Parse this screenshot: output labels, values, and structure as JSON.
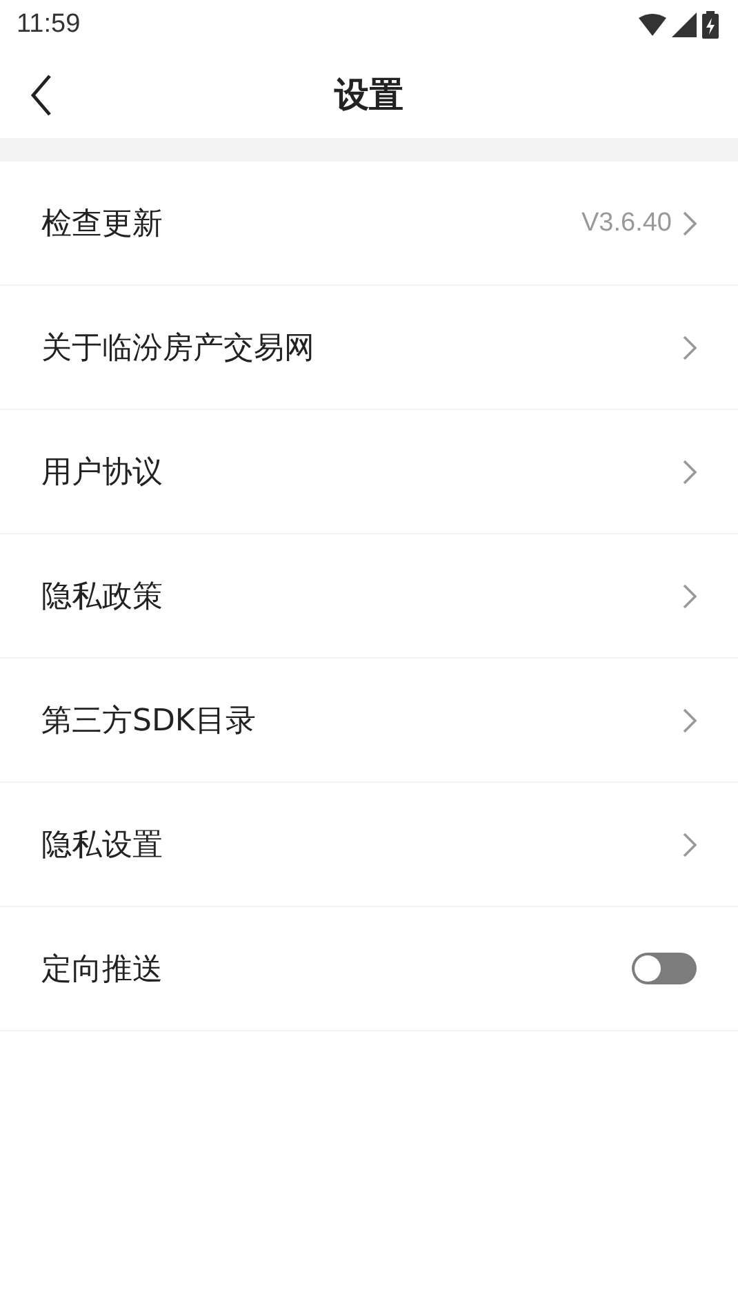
{
  "status_bar": {
    "time": "11:59"
  },
  "header": {
    "title": "设置"
  },
  "rows": [
    {
      "kind": "link",
      "label": "检查更新",
      "value": "V3.6.40"
    },
    {
      "kind": "link",
      "label": "关于临汾房产交易网"
    },
    {
      "kind": "link",
      "label": "用户协议"
    },
    {
      "kind": "link",
      "label": "隐私政策"
    },
    {
      "kind": "link",
      "label": "第三方SDK目录"
    },
    {
      "kind": "link",
      "label": "隐私设置"
    },
    {
      "kind": "toggle",
      "label": "定向推送",
      "on": false
    }
  ]
}
